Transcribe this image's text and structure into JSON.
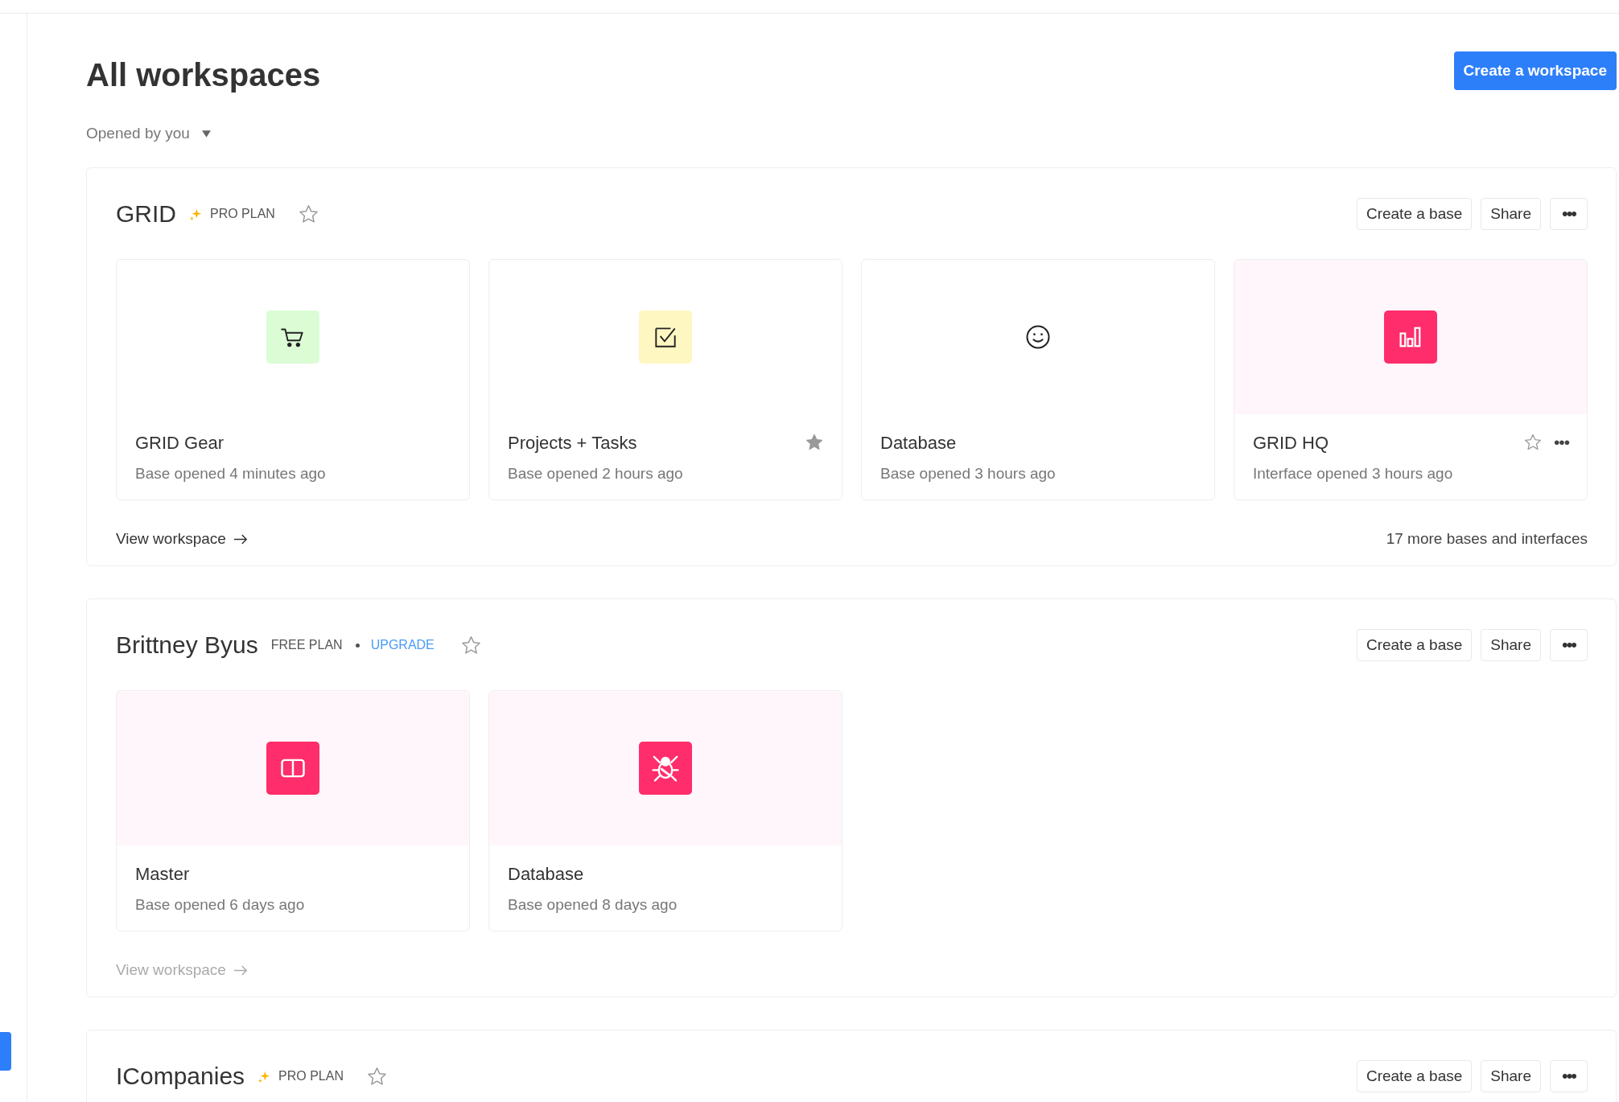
{
  "page": {
    "title": "All workspaces",
    "create_button": "Create a workspace",
    "filter": "Opened by you"
  },
  "workspaces": [
    {
      "name": "GRID",
      "plan": {
        "kind": "pro",
        "label": "PRO PLAN"
      },
      "starred": false,
      "create_button": "Create a base",
      "share_button": "Share",
      "more_button": "•••",
      "bases": [
        {
          "name": "GRID Gear",
          "subtitle": "Base opened 4 minutes ago",
          "kind": "light",
          "color": "#dcfcd6",
          "starred": false,
          "hovered": false
        },
        {
          "name": "Projects + Tasks",
          "subtitle": "Base opened 2 hours ago",
          "kind": "light",
          "color": "#fff7c2",
          "starred": true,
          "hovered": false
        },
        {
          "name": "Database",
          "subtitle": "Base opened 3 hours ago",
          "kind": "plain",
          "color": "#ffffff",
          "starred": false,
          "hovered": false
        },
        {
          "name": "GRID HQ",
          "subtitle": "Interface opened 3 hours ago",
          "kind": "bold",
          "color": "#ff2d6b",
          "starred": false,
          "hovered": true,
          "more": "•••"
        }
      ],
      "view_link": {
        "label": "View workspace",
        "disabled": false
      },
      "more_count": "17 more bases and interfaces"
    },
    {
      "name": "Brittney Byus",
      "plan": {
        "kind": "free",
        "label": "FREE PLAN",
        "upgrade": "UPGRADE"
      },
      "starred": false,
      "create_button": "Create a base",
      "share_button": "Share",
      "more_button": "•••",
      "bases": [
        {
          "name": "Master",
          "subtitle": "Base opened 6 days ago",
          "kind": "bold",
          "color": "#ff2d6b",
          "starred": false,
          "hovered": false
        },
        {
          "name": "Database",
          "subtitle": "Base opened 8 days ago",
          "kind": "bold",
          "color": "#ff2d6b",
          "starred": false,
          "hovered": false
        }
      ],
      "view_link": {
        "label": "View workspace",
        "disabled": true
      }
    },
    {
      "name": "ICompanies",
      "plan": {
        "kind": "pro",
        "label": "PRO PLAN"
      },
      "starred": false,
      "create_button": "Create a base",
      "share_button": "Share",
      "more_button": "•••"
    }
  ]
}
